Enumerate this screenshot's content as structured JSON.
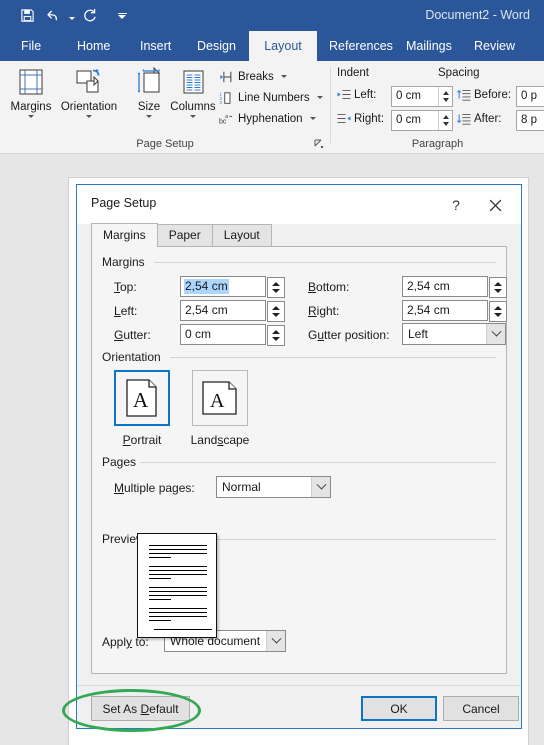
{
  "window": {
    "title": "Document2 - Word",
    "quick_access": [
      {
        "name": "save-icon",
        "label": "Save"
      },
      {
        "name": "undo-icon",
        "label": "Undo"
      },
      {
        "name": "redo-icon",
        "label": "Redo"
      },
      {
        "name": "customize-quick-access-icon",
        "label": "Customize Quick Access Toolbar"
      }
    ]
  },
  "ribbon": {
    "tabs": [
      {
        "label": "File",
        "active": false
      },
      {
        "label": "Home",
        "active": false
      },
      {
        "label": "Insert",
        "active": false
      },
      {
        "label": "Design",
        "active": false
      },
      {
        "label": "Layout",
        "active": true
      },
      {
        "label": "References",
        "active": false
      },
      {
        "label": "Mailings",
        "active": false
      },
      {
        "label": "Review",
        "active": false
      }
    ],
    "page_setup": {
      "group_label": "Page Setup",
      "buttons": [
        {
          "label": "Margins",
          "icon": "margins-icon"
        },
        {
          "label": "Orientation",
          "icon": "orientation-icon"
        },
        {
          "label": "Size",
          "icon": "size-icon"
        },
        {
          "label": "Columns",
          "icon": "columns-icon"
        }
      ],
      "small_buttons": [
        {
          "label": "Breaks",
          "icon": "breaks-icon"
        },
        {
          "label": "Line Numbers",
          "icon": "line-numbers-icon"
        },
        {
          "label": "Hyphenation",
          "icon": "hyphenation-icon"
        }
      ]
    },
    "paragraph": {
      "group_label": "Paragraph",
      "indent_label": "Indent",
      "spacing_label": "Spacing",
      "indent_left_label": "Left:",
      "indent_left_value": "0 cm",
      "indent_right_label": "Right:",
      "indent_right_value": "0 cm",
      "spacing_before_label": "Before:",
      "spacing_before_value": "0 p",
      "spacing_after_label": "After:",
      "spacing_after_value": "8 p"
    }
  },
  "dialog": {
    "title": "Page Setup",
    "help_label": "?",
    "close_label": "✕",
    "tabs": [
      {
        "label": "Margins",
        "active": true
      },
      {
        "label": "Paper",
        "active": false
      },
      {
        "label": "Layout",
        "active": false
      }
    ],
    "margins": {
      "group_label": "Margins",
      "top_label": "Top:",
      "top_value": "2,54 cm",
      "bottom_label": "Bottom:",
      "bottom_value": "2,54 cm",
      "left_label": "Left:",
      "left_value": "2,54 cm",
      "right_label": "Right:",
      "right_value": "2,54 cm",
      "gutter_label": "Gutter:",
      "gutter_value": "0 cm",
      "gutter_position_label": "Gutter position:",
      "gutter_position_value": "Left"
    },
    "orientation": {
      "group_label": "Orientation",
      "portrait_label": "Portrait",
      "landscape_label": "Landscape",
      "selected": "Portrait"
    },
    "pages": {
      "group_label": "Pages",
      "multiple_pages_label": "Multiple pages:",
      "multiple_pages_value": "Normal"
    },
    "preview": {
      "group_label": "Preview"
    },
    "apply_to_label": "Apply to:",
    "apply_to_value": "Whole document",
    "set_as_default_label": "Set As Default",
    "ok_label": "OK",
    "cancel_label": "Cancel"
  },
  "annotation": {
    "shape": "ellipse",
    "color": "#35a853",
    "target": "Set As Default"
  },
  "colors": {
    "word_blue": "#2b579a",
    "dialog_border": "#2b79c8",
    "focus_blue": "#0d74c8",
    "selection_blue": "#add6ff",
    "annotation_green": "#35a853"
  }
}
